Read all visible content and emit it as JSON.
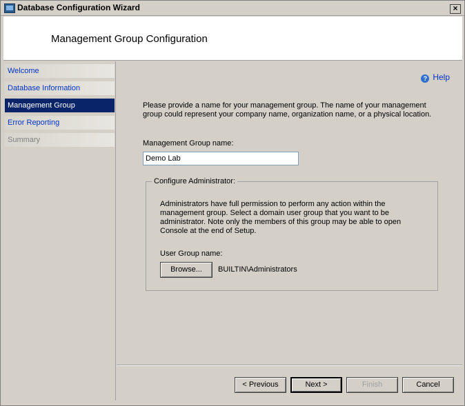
{
  "window": {
    "title": "Database Configuration Wizard",
    "close_label": "×"
  },
  "header": {
    "title": "Management Group Configuration"
  },
  "nav": {
    "items": [
      {
        "label": "Welcome",
        "state": "link"
      },
      {
        "label": "Database Information",
        "state": "link"
      },
      {
        "label": "Management Group",
        "state": "active"
      },
      {
        "label": "Error Reporting",
        "state": "link"
      },
      {
        "label": "Summary",
        "state": "disabled"
      }
    ]
  },
  "content": {
    "help_label": "Help",
    "intro": "Please provide a name for your management group. The name of your management group could represent your company name, organization name, or a physical location.",
    "mg_name_label": "Management Group name:",
    "mg_name_value": "Demo Lab",
    "admin_group": {
      "legend": "Configure Administrator:",
      "description": "Administrators have full permission to perform any action within the management group. Select a domain user group that you want to be administrator. Note only the members of this group may be able to open Console at the end of Setup.",
      "user_group_label": "User Group name:",
      "browse_label": "Browse...",
      "user_group_value": "BUILTIN\\Administrators"
    }
  },
  "footer": {
    "previous_label": "< Previous",
    "next_label": "Next >",
    "finish_label": "Finish",
    "cancel_label": "Cancel"
  }
}
